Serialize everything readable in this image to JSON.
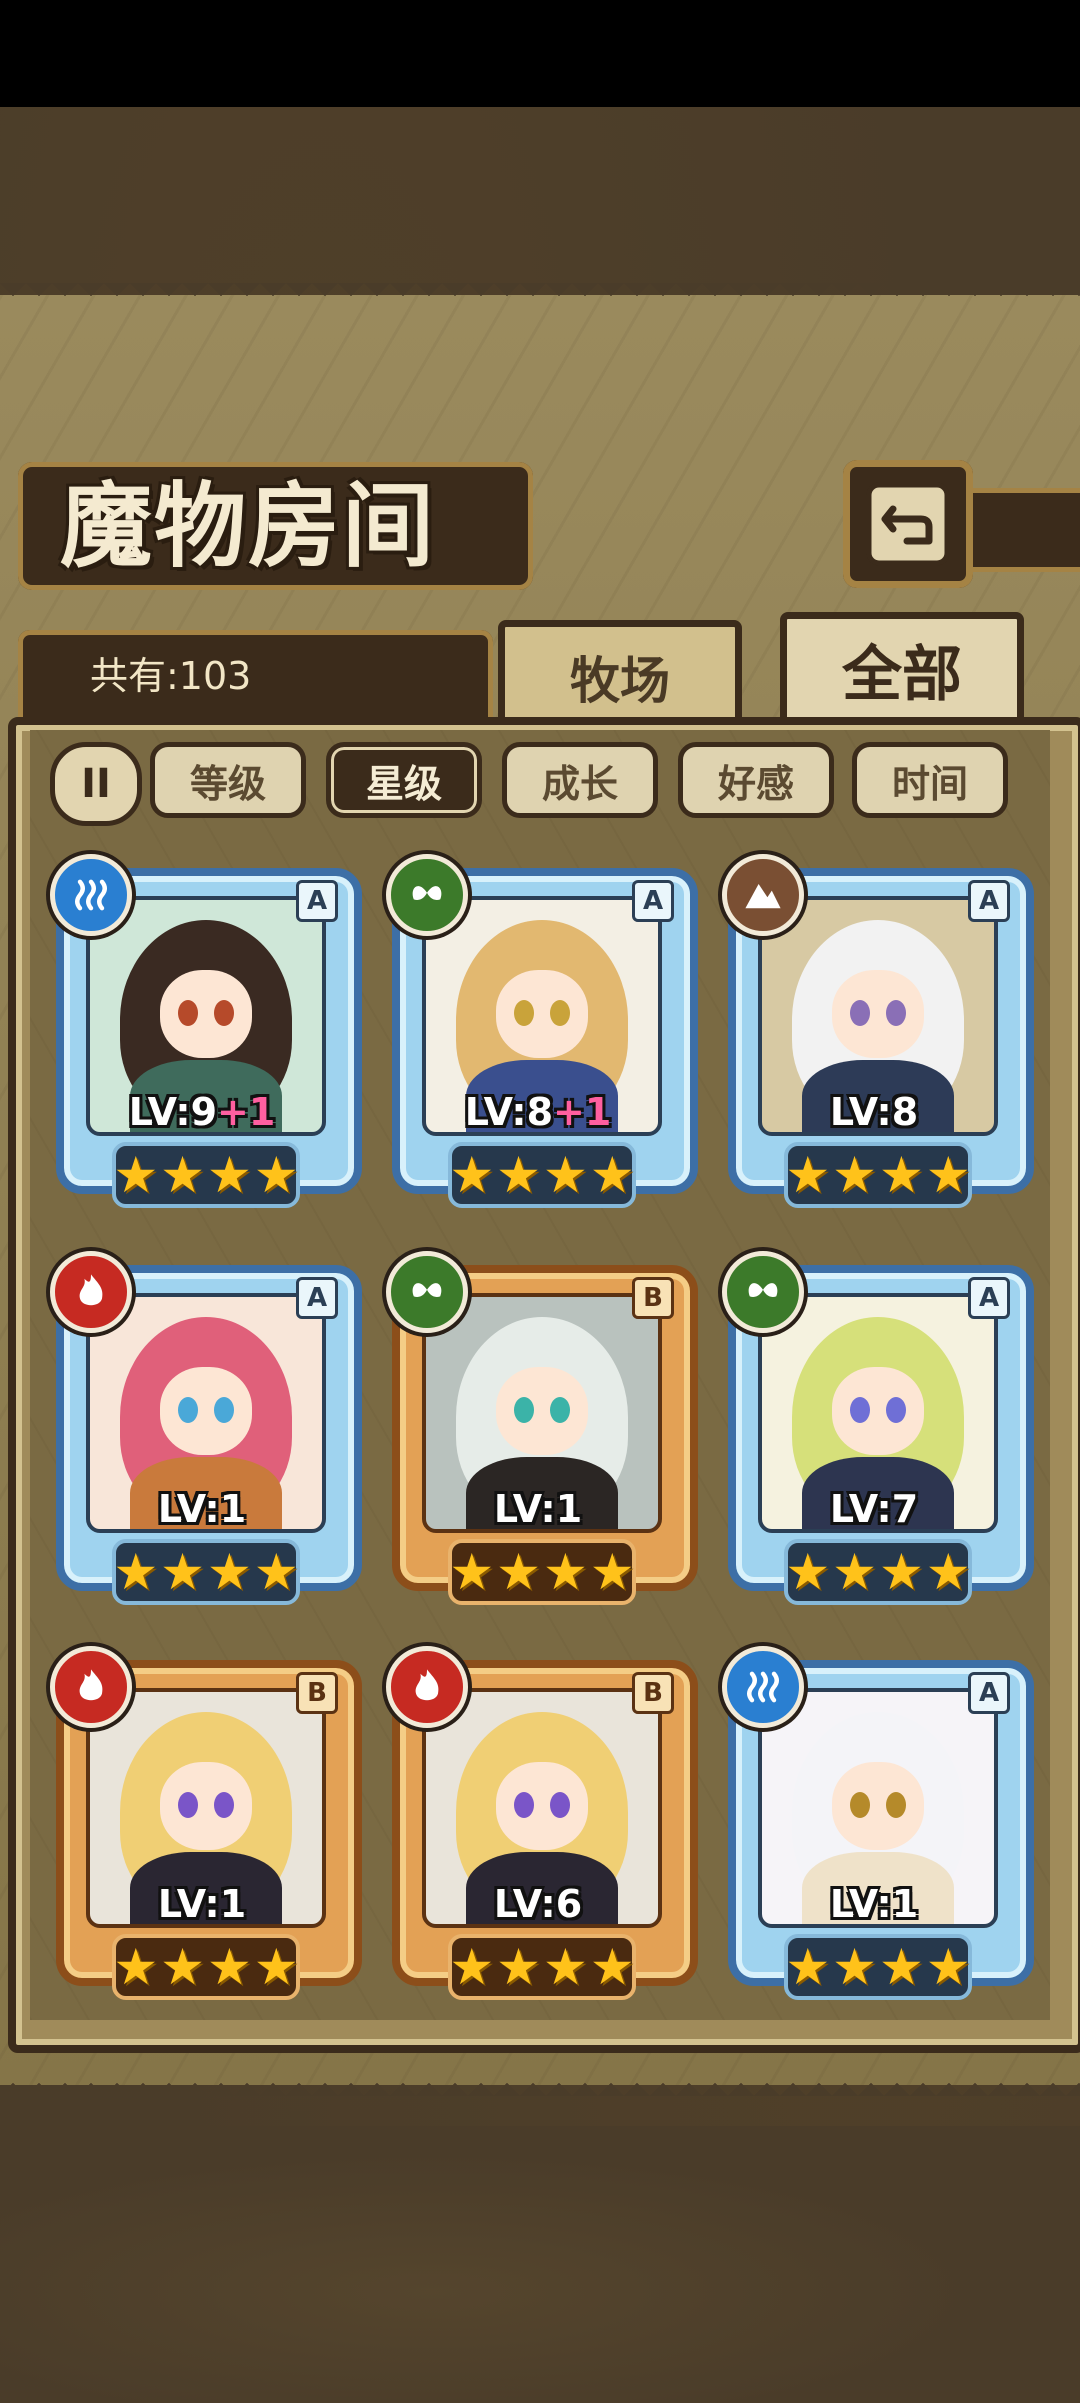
{
  "title": "魔物房间",
  "count_label": "共有:103",
  "tabs": [
    {
      "label": "牧场",
      "active": false
    },
    {
      "label": "全部",
      "active": true
    }
  ],
  "sort_toggle": "II",
  "filters": [
    {
      "label": "等级",
      "active": false
    },
    {
      "label": "星级",
      "active": true
    },
    {
      "label": "成长",
      "active": false
    },
    {
      "label": "好感",
      "active": false
    },
    {
      "label": "时间",
      "active": false
    }
  ],
  "monsters": [
    {
      "element": "water",
      "rank": "A",
      "level": "LV:9",
      "bonus": "+1",
      "stars": 4,
      "frame": "silver"
    },
    {
      "element": "leaf",
      "rank": "A",
      "level": "LV:8",
      "bonus": "+1",
      "stars": 4,
      "frame": "silver"
    },
    {
      "element": "rock",
      "rank": "A",
      "level": "LV:8",
      "bonus": "",
      "stars": 4,
      "frame": "silver"
    },
    {
      "element": "fire",
      "rank": "A",
      "level": "LV:1",
      "bonus": "",
      "stars": 4,
      "frame": "silver"
    },
    {
      "element": "leaf",
      "rank": "B",
      "level": "LV:1",
      "bonus": "",
      "stars": 4,
      "frame": "bronze"
    },
    {
      "element": "leaf",
      "rank": "A",
      "level": "LV:7",
      "bonus": "",
      "stars": 4,
      "frame": "silver"
    },
    {
      "element": "fire",
      "rank": "B",
      "level": "LV:1",
      "bonus": "",
      "stars": 4,
      "frame": "bronze"
    },
    {
      "element": "fire",
      "rank": "B",
      "level": "LV:6",
      "bonus": "",
      "stars": 4,
      "frame": "bronze"
    },
    {
      "element": "water",
      "rank": "A",
      "level": "LV:1",
      "bonus": "",
      "stars": 4,
      "frame": "silver"
    }
  ],
  "icons": {
    "back": "back-arrow-icon",
    "water": "water-waves-icon",
    "leaf": "leaf-icon",
    "rock": "mountain-icon",
    "fire": "flame-icon",
    "star": "star-icon"
  },
  "colors": {
    "accent_dark": "#3b2b1b",
    "star": "#ffc21a",
    "frame_silver": "#3d6fa6",
    "frame_bronze": "#8c4e1a"
  }
}
